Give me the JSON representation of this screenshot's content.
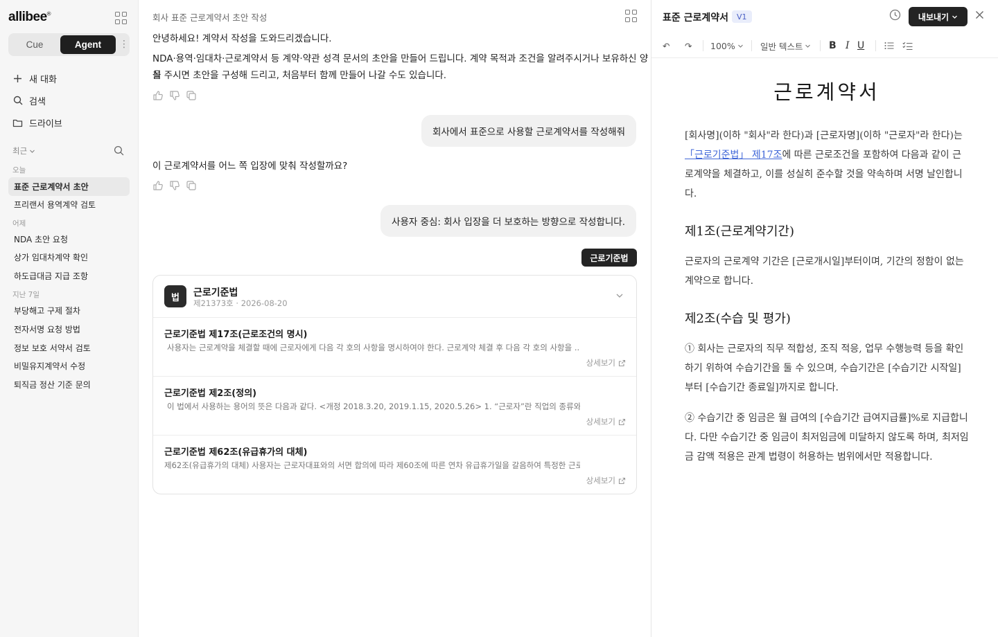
{
  "sidebar": {
    "logo": "allibee",
    "logo_mark": "®",
    "modes": {
      "cue": "Cue",
      "agent": "Agent",
      "active": "Agent"
    },
    "nav": [
      {
        "label": "새 대화",
        "icon": "plus-icon"
      },
      {
        "label": "검색",
        "icon": "search-icon"
      },
      {
        "label": "드라이브",
        "icon": "folder-icon"
      }
    ],
    "recent_label": "최근",
    "groups": [
      {
        "label": "오늘",
        "items": [
          "표준 근로계약서 초안",
          "프리랜서 용역계약 검토"
        ]
      },
      {
        "label": "어제",
        "items": [
          "NDA 초안 요청",
          "상가 임대차계약 확인",
          "하도급대금 지급 조항"
        ]
      },
      {
        "label": "지난 7일",
        "items": [
          "부당해고 구제 절차",
          "전자서명 요청 방법",
          "정보 보호 서약서 검토",
          "비밀유지계약서 수정",
          "퇴직금 정산 기준 문의"
        ]
      }
    ]
  },
  "chat": {
    "title": "회사 표준 근로계약서 초안 작성",
    "greeting": "안녕하세요! 계약서 작성을 도와드리겠습니다.",
    "intro_line1": "NDA·용역·임대차·근로계약서 등 계약·약관 성격 문서의 초안을 만들어 드립니다. 계약 목적과 조건을 알려주시거나 보유하신 양식",
    "intro_line2": "을 주시면 초안을 구성해 드리고, 처음부터 함께 만들어 나갈 수도 있습니다.",
    "user_msg_1": "회사에서 표준으로 사용할 근로계약서를 작성해줘",
    "bot_question": "이 근로계약서를 어느 쪽 입장에 맞춰 작성할까요?",
    "user_msg_2": "사용자 중심: 회사 입장을 더 보호하는 방향으로 작성합니다.",
    "law_chip": "근로기준법",
    "law_card": {
      "badge": "법",
      "name": "근로기준법",
      "meta": "제21373호 · 2026-08-20",
      "more_label": "상세보기",
      "articles": [
        {
          "title": "근로기준법 제17조(근로조건의 명시)",
          "snippet": "사용자는 근로계약을 체결할 때에 근로자에게 다음 각 호의 사항을 명시하여야 한다. 근로계약 체결 후 다음 각 호의 사항을 ..."
        },
        {
          "title": "근로기준법 제2조(정의)",
          "snippet": "이 법에서 사용하는 용어의 뜻은 다음과 같다. <개정 2018.3.20, 2019.1.15, 2020.5.26> 1. “근로자”란 직업의 종류와 관..."
        },
        {
          "title": "근로기준법 제62조(유급휴가의 대체)",
          "snippet": "제62조(유급휴가의 대체) 사용자는 근로자대표와의 서면 합의에 따라 제60조에 따른 연차 유급휴가일을 갈음하여 특정한 근로..."
        }
      ]
    }
  },
  "editor": {
    "doc_title": "표준 근로계약서",
    "version": "V1",
    "export_label": "내보내기",
    "toolbar": {
      "undo": "↶",
      "redo": "↷",
      "zoom": "100%",
      "style": "일반 텍스트",
      "bold": "B",
      "italic": "I",
      "underline": "U"
    },
    "doc": {
      "heading": "근로계약서",
      "p1_before": "[회사명](이하 \"회사\"라 한다)과 [근로자명](이하 \"근로자\"라 한다)는 ",
      "p1_link": "「근로기준법」 제17조",
      "p1_after": "에 따른 근로조건을 포함하여 다음과 같이 근로계약을 체결하고, 이를 성실히 준수할 것을 약속하며 서명 날인합니다.",
      "sections": [
        {
          "title": "제1조(근로계약기간)",
          "paragraphs": [
            "근로자의 근로계약 기간은 [근로개시일]부터이며, 기간의 정함이 없는 계약으로 합니다."
          ]
        },
        {
          "title": "제2조(수습 및 평가)",
          "paragraphs": [
            "① 회사는 근로자의 직무 적합성, 조직 적응, 업무 수행능력 등을 확인하기 위하여 수습기간을 둘 수 있으며, 수습기간은 [수습기간 시작일]부터 [수습기간 종료일]까지로 합니다.",
            "② 수습기간 중 임금은 월 급여의 [수습기간 급여지급률]%로 지급합니다. 다만 수습기간 중 임금이 최저임금에 미달하지 않도록 하며, 최저임금 감액 적용은 관계 법령이 허용하는 범위에서만 적용합니다."
          ]
        }
      ]
    }
  }
}
